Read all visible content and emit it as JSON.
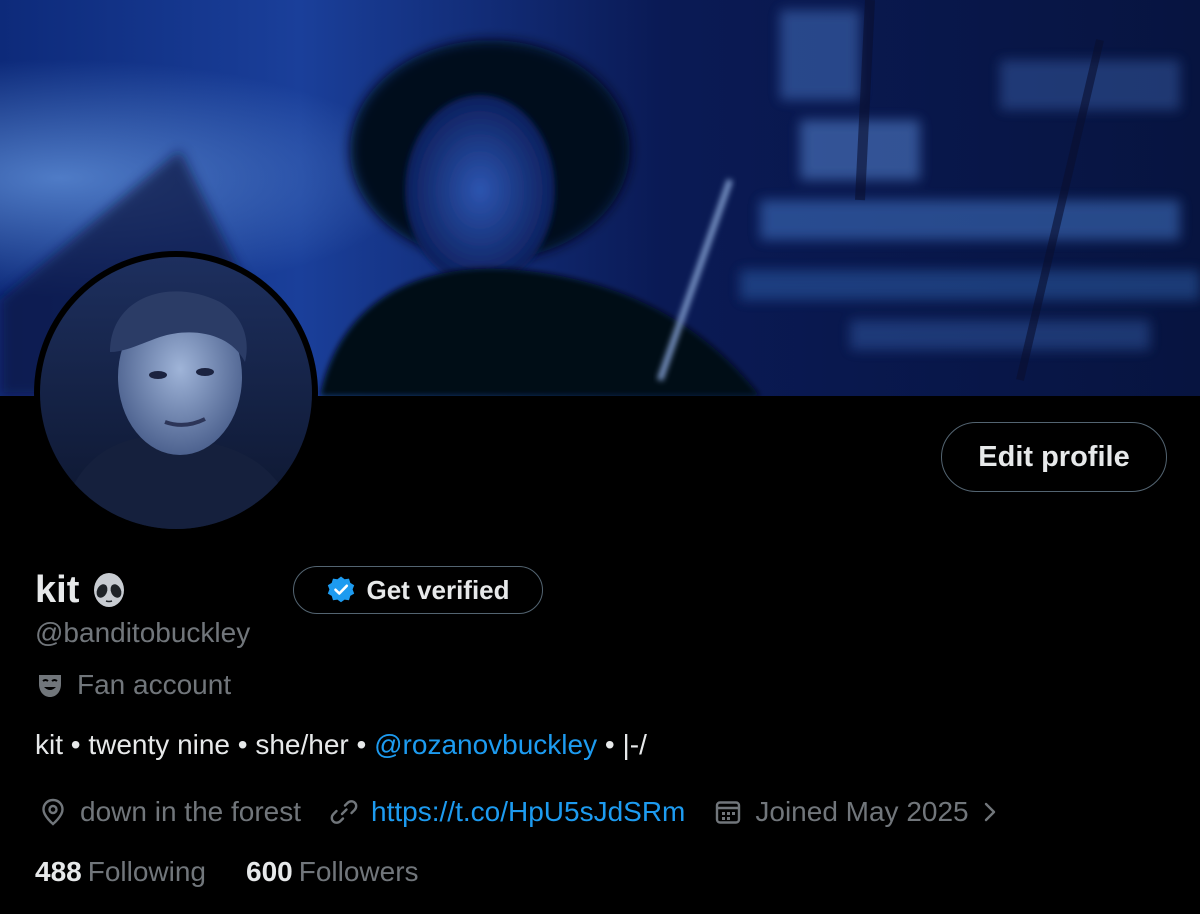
{
  "profile": {
    "display_name": "kit",
    "name_emoji": "alien-face",
    "handle": "@banditobuckley",
    "category": "Fan account",
    "category_icon": "theater-mask-icon",
    "edit_profile_label": "Edit profile",
    "get_verified_label": "Get verified",
    "bio_parts": {
      "before": "kit • twenty nine • she/her • ",
      "mention": "@rozanovbuckley",
      "after": " • |-/"
    },
    "location": "down in the forest",
    "website": "https://t.co/HpU5sJdSRm",
    "joined": "Joined May 2025",
    "following_count": "488",
    "following_label": "Following",
    "followers_count": "600",
    "followers_label": "Followers"
  },
  "colors": {
    "background": "#000000",
    "text_primary": "#e7e9ea",
    "text_secondary": "#71767b",
    "link": "#1d9bf0",
    "border": "#536471"
  }
}
